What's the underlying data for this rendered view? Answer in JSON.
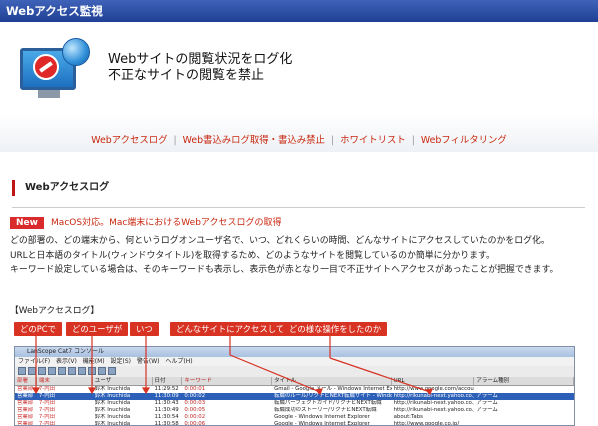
{
  "titlebar": {
    "title": "Webアクセス監視"
  },
  "hero": {
    "line1": "Webサイトの閲覧状況をログ化",
    "line2": "不正なサイトの閲覧を禁止"
  },
  "nav": {
    "items": [
      "Webアクセスログ",
      "Web書込みログ取得・書込み禁止",
      "ホワイトリスト",
      "Webフィルタリング"
    ],
    "separator": "|"
  },
  "section": {
    "title": "Webアクセスログ"
  },
  "notice": {
    "badge": "New",
    "text": "MacOS対応。Mac端末におけるWebアクセスログの取得"
  },
  "body": {
    "lines": [
      "どの部署の、どの端末から、何というログオンユーザ名で、いつ、どれくらいの時間、どんなサイトにアクセスしていたのかをログ化。",
      "URLと日本語のタイトル(ウィンドウタイトル)を取得するため、どのようなサイトを閲覧しているのか簡単に分かります。",
      "キーワード設定している場合は、そのキーワードも表示し、表示色が赤となり一目で不正サイトへアクセスがあったことが把握できます。"
    ]
  },
  "caption": "【Webアクセスログ】",
  "callouts": [
    "どのPCで",
    "どのユーザが",
    "いつ",
    "どんなサイトにアクセスして",
    "どの様な操作をしたのか"
  ],
  "screenshot": {
    "window_title": "LanScope Cat7 コンソール",
    "menu": "ファイル(F)  表示(V)  機能(M)  設定(S)  警告(W)  ヘルプ(H)",
    "columns": [
      "部署",
      "端末",
      "ユーザ",
      "日付",
      "キーワード",
      "タイトル",
      "URL",
      "アラーム種別"
    ],
    "rows": [
      [
        "営業部",
        "7-内田",
        "鈴木 Inuchida",
        "11:29:52",
        "0:00:01",
        "Gmail - Google メール - Windows Internet Explorer",
        "http://www.google.com/accounts/ServiceLogin",
        ""
      ],
      [
        "営業部",
        "7-内田",
        "鈴木 Inuchida",
        "11:30:09",
        "0:00:02",
        "転職のルール/リクナビNEXT転職サイト - Windows",
        "http://rikunabi-next.yahoo.co.jp/",
        "アラーム"
      ],
      [
        "営業部",
        "7-内田",
        "鈴木 Inuchida",
        "11:30:43",
        "0:00:03",
        "転職パーフェクトガイド/リクナビNEXT転職",
        "http://rikunabi-next.yahoo.co.jp/perfect/",
        "アラーム"
      ],
      [
        "営業部",
        "7-内田",
        "鈴木 Inuchida",
        "11:30:49",
        "0:00:05",
        "転職成功のストーリー/リクナビNEXT転職",
        "http://rikunabi-next.yahoo.co.jp/shinnet/",
        "アラーム"
      ],
      [
        "営業部",
        "7-内田",
        "鈴木 Inuchida",
        "11:30:54",
        "0:00:02",
        "Google - Windows Internet Explorer",
        "about:Tabs",
        ""
      ],
      [
        "営業部",
        "7-内田",
        "鈴木 Inuchida",
        "11:30:58",
        "0:00:06",
        "Google - Windows Internet Explorer",
        "http://www.google.co.jp/",
        ""
      ]
    ]
  },
  "colors": {
    "accent": "#c8280f",
    "badge": "#d92b2b",
    "titlebar": "#2a4aa3",
    "selection": "#2b5fb8"
  }
}
